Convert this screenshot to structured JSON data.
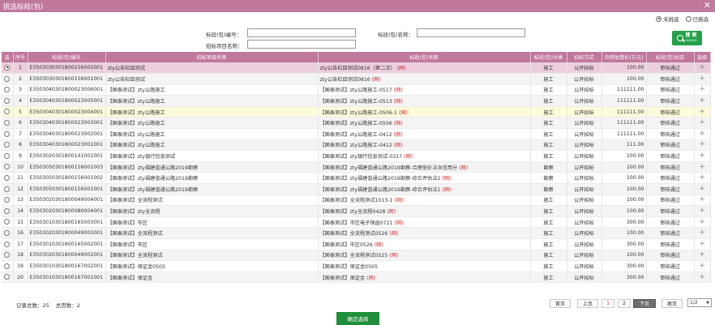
{
  "window": {
    "title": "挑选标段(包)",
    "close_glyph": "✕"
  },
  "filters": {
    "unselected": "未挑选",
    "selected": "已挑选"
  },
  "search": {
    "code_label": "标段(包)编号：",
    "name_label": "标段(包)名称：",
    "project_label": "招标项目名称：",
    "code_value": "",
    "name_value": "",
    "project_value": "",
    "button_label": "搜 索",
    "button_sub": "SEARCH"
  },
  "table": {
    "headers": [
      "选",
      "序号",
      "标段(包)编号",
      "招标项目名称",
      "标段(包)名称",
      "标段(包)分类",
      "招标方式",
      "合同估算价(万元)",
      "标段(包)状态",
      "选择"
    ],
    "rows": [
      {
        "seq": "1",
        "code": "E3503030301800156002001",
        "project": "zty公告栏目测试",
        "name": "zty公告栏目测试0816（第二次）",
        "tag": "(网)",
        "category": "施工",
        "method": "公开招标",
        "price": "100.00",
        "status": "审核通过"
      },
      {
        "seq": "2",
        "code": "E3503030301800156001001",
        "project": "zty公告栏目测试",
        "name": "zty公告栏目测试0816",
        "tag": "(网)",
        "category": "施工",
        "method": "公开招标",
        "price": "100.00",
        "status": "审核通过"
      },
      {
        "seq": "3",
        "code": "E3503040301800023006001",
        "project": "【国泰测试】zty公路施工",
        "name": "【国泰测试】zty公路施工-0517",
        "tag": "(网)",
        "category": "施工",
        "method": "公开招标",
        "price": "111111.00",
        "status": "审核通过"
      },
      {
        "seq": "4",
        "code": "E3503040301800023005001",
        "project": "【国泰测试】zty公路施工",
        "name": "【国泰测试】zty公路施工-0513",
        "tag": "(网)",
        "category": "施工",
        "method": "公开招标",
        "price": "111111.00",
        "status": "审核通过"
      },
      {
        "seq": "5",
        "code": "E3503040301800023004001",
        "project": "【国泰测试】zty公路施工",
        "name": "【国泰测试】zty公路施工-0506-1",
        "tag": "(网)",
        "category": "施工",
        "method": "公开招标",
        "price": "111111.00",
        "status": "审核通过"
      },
      {
        "seq": "6",
        "code": "E3503040301800023003001",
        "project": "【国泰测试】zty公路施工",
        "name": "【国泰测试】zty公路施工-0506",
        "tag": "(网)",
        "category": "施工",
        "method": "公开招标",
        "price": "111111.00",
        "status": "审核通过"
      },
      {
        "seq": "7",
        "code": "E3503040301800023002001",
        "project": "【国泰测试】zty公路施工",
        "name": "【国泰测试】zty公路施工-0412",
        "tag": "(网)",
        "category": "施工",
        "method": "公开招标",
        "price": "111111.00",
        "status": "审核通过"
      },
      {
        "seq": "8",
        "code": "E3503040301800023001001",
        "project": "【国泰测试】zty公路施工",
        "name": "【国泰测试】zty公路施工-0412",
        "tag": "(网)",
        "category": "施工",
        "method": "公开招标",
        "price": "111.00",
        "status": "审核通过"
      },
      {
        "seq": "9",
        "code": "E3503020301800141001001",
        "project": "【国泰测试】zty银行信息测试",
        "name": "【国泰测试】zty银行信息测试-0317",
        "tag": "(网)",
        "category": "施工",
        "method": "公开招标",
        "price": "100.00",
        "status": "审核通过"
      },
      {
        "seq": "10",
        "code": "E3503050301800156001003",
        "project": "【国泰测试】zty福建普通公路2019勘察",
        "name": "【国泰测试】zty福建普通公路2019勘察-合理低价法含信用分",
        "tag": "(网)",
        "category": "勘察",
        "method": "公开招标",
        "price": "100.00",
        "status": "审核通过"
      },
      {
        "seq": "11",
        "code": "E3503050301800156001002",
        "project": "【国泰测试】zty福建普通公路2019勘察",
        "name": "【国泰测试】zty福建普通公路2019勘察-综合评估法2",
        "tag": "(网)",
        "category": "勘察",
        "method": "公开招标",
        "price": "100.00",
        "status": "审核通过"
      },
      {
        "seq": "12",
        "code": "E3503050301800156001001",
        "project": "【国泰测试】zty福建普通公路2019勘察",
        "name": "【国泰测试】zty福建普通公路2019勘察-综合评估法1",
        "tag": "(网)",
        "category": "勘察",
        "method": "公开招标",
        "price": "100.00",
        "status": "审核通过"
      },
      {
        "seq": "13",
        "code": "E3503020301800049004001",
        "project": "【国泰测试】全流程测试",
        "name": "【国泰测试】全流程测试1013-1",
        "tag": "(网)",
        "category": "施工",
        "method": "公开招标",
        "price": "100.00",
        "status": "审核通过"
      },
      {
        "seq": "14",
        "code": "E3503020301800080004001",
        "project": "【国泰测试】zty全流程",
        "name": "【国泰测试】zty全流程0428",
        "tag": "(网)",
        "category": "施工",
        "method": "公开招标",
        "price": "100.00",
        "status": "审核通过"
      },
      {
        "seq": "15",
        "code": "E3503010301800165003001",
        "project": "【国泰测试】市区",
        "name": "【国泰测试】市区电子保函0721",
        "tag": "(网)",
        "category": "施工",
        "method": "公开招标",
        "price": "300.00",
        "status": "审核通过"
      },
      {
        "seq": "16",
        "code": "E3503020301800049003001",
        "project": "【国泰测试】全流程测试",
        "name": "【国泰测试】全流程测试0526",
        "tag": "(网)",
        "category": "施工",
        "method": "公开招标",
        "price": "100.00",
        "status": "审核通过"
      },
      {
        "seq": "17",
        "code": "E3503010301800165002001",
        "project": "【国泰测试】市区",
        "name": "【国泰测试】市区0526",
        "tag": "(网)",
        "category": "施工",
        "method": "公开招标",
        "price": "300.00",
        "status": "审核通过"
      },
      {
        "seq": "18",
        "code": "E3503020301800049002001",
        "project": "【国泰测试】全流程测试",
        "name": "【国泰测试】全流程测试0525",
        "tag": "(网)",
        "category": "施工",
        "method": "公开招标",
        "price": "100.00",
        "status": "审核通过"
      },
      {
        "seq": "19",
        "code": "E3503010301800167002001",
        "project": "【国泰测试】保证金0505",
        "name": "【国泰测试】保证金0505",
        "tag": "",
        "category": "施工",
        "method": "公开招标",
        "price": "300.00",
        "status": "审核通过"
      },
      {
        "seq": "20",
        "code": "E3503010301800167001001",
        "project": "【国泰测试】保证金",
        "name": "【国泰测试】保证金",
        "tag": "(网)",
        "category": "施工",
        "method": "公开招标",
        "price": "300.00",
        "status": "审核通过"
      }
    ],
    "select_glyph": "+"
  },
  "footer": {
    "total_records": "记录总数：25",
    "total_pages": "总页数：2"
  },
  "pagination": {
    "first": "首页",
    "prev": "上页",
    "page1": "1",
    "page2": "2",
    "next": "下页",
    "last": "尾页",
    "current": "1/2",
    "dropdown_glyph": "▼"
  },
  "confirm_label": "确定选择",
  "colors": {
    "accent": "#c0789b",
    "selected_row": "#eccfdd",
    "hover_row": "#fdfbd9",
    "button_green": "#24a048",
    "tag_red": "#d0262e"
  }
}
